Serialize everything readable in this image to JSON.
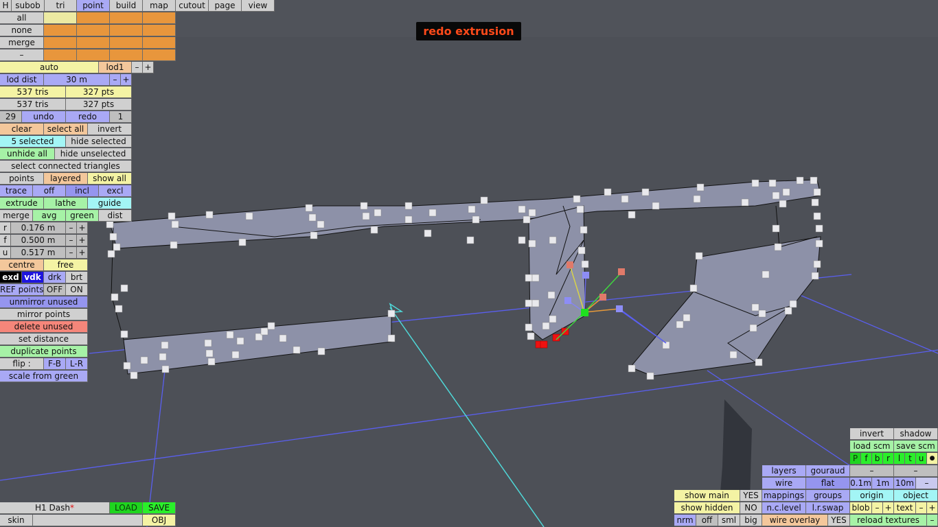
{
  "status_message": "redo extrusion",
  "top_tabs": [
    "H",
    "subob",
    "tri",
    "point",
    "build",
    "map",
    "cutout",
    "page",
    "view"
  ],
  "active_tab": "point",
  "selection_rows": [
    "all",
    "none",
    "merge",
    "–"
  ],
  "lod": {
    "auto": "auto",
    "level": "lod1",
    "minus": "–",
    "plus": "+",
    "dist_label": "lod dist",
    "dist_value": "30 m",
    "tris_1": "537 tris",
    "pts_1": "327 pts",
    "tris_2": "537 tris",
    "pts_2": "327 pts"
  },
  "history": {
    "count": "29",
    "undo": "undo",
    "redo": "redo",
    "redo_count": "1"
  },
  "select": {
    "clear": "clear",
    "select_all": "select all",
    "invert": "invert",
    "selected": "5 selected",
    "hide_selected": "hide selected",
    "unhide_all": "unhide all",
    "hide_unselected": "hide unselected",
    "connected": "select connected triangles"
  },
  "points_row": {
    "points": "points",
    "layered": "layered",
    "show_all": "show all"
  },
  "trace_row": {
    "trace": "trace",
    "off": "off",
    "incl": "incl",
    "excl": "excl"
  },
  "tools_row": {
    "extrude": "extrude",
    "lathe": "lathe",
    "guide": "guide"
  },
  "merge_row": {
    "merge": "merge",
    "avg": "avg",
    "green": "green",
    "dist": "dist"
  },
  "params": [
    {
      "label": "r",
      "value": "0.176 m"
    },
    {
      "label": "f",
      "value": "0.500 m"
    },
    {
      "label": "u",
      "value": "0.517 m"
    }
  ],
  "pivot": {
    "centre": "centre",
    "free": "free"
  },
  "display_modes": [
    "exd",
    "vdk",
    "drk",
    "brt"
  ],
  "ref_points": {
    "label": "REF points",
    "off": "OFF",
    "on": "ON"
  },
  "point_ops": [
    "unmirror unused",
    "mirror points",
    "delete unused",
    "set distance",
    "duplicate points"
  ],
  "flip": {
    "label": "flip :",
    "fb": "F-B",
    "lr": "L-R"
  },
  "scale_from_green": "scale from green",
  "file": {
    "name": "H1 Dash",
    "modified_mark": "*",
    "load": "LOAD",
    "save": "SAVE",
    "skin": "skin",
    "obj": "OBJ"
  },
  "bottom_mid": {
    "show_main": "show main",
    "show_main_val": "YES",
    "show_hidden": "show hidden",
    "show_hidden_val": "NO",
    "nrm": "nrm",
    "off": "off",
    "sml": "sml",
    "big": "big"
  },
  "render_opts": {
    "layers": "layers",
    "gouraud": "gouraud",
    "wire": "wire",
    "flat": "flat",
    "mappings": "mappings",
    "groups": "groups",
    "nc_level": "n.c.level",
    "lr_swap": "l.r.swap",
    "wire_overlay": "wire overlay",
    "wire_overlay_val": "YES"
  },
  "right_panel": {
    "invert": "invert",
    "shadow": "shadow",
    "load_scm": "load scm",
    "save_scm": "save scm",
    "views": [
      "P",
      "f",
      "b",
      "r",
      "l",
      "t",
      "u"
    ],
    "dot": "●",
    "dash1": "–",
    "dash2": "–",
    "grid": [
      "0.1m",
      "1m",
      "10m",
      "–"
    ],
    "origin": "origin",
    "object": "object",
    "blob": "blob",
    "text": "text",
    "minus": "–",
    "plus": "+",
    "reload": "reload textures",
    "reload_minus": "–"
  },
  "colors": {
    "background": "#50535a",
    "ground": "#4d5057",
    "mesh_fill": "#8d91a8",
    "grid_line": "#5a5ff0",
    "axis_line": "#4fd8d8",
    "status_text": "#ff4a1a"
  }
}
